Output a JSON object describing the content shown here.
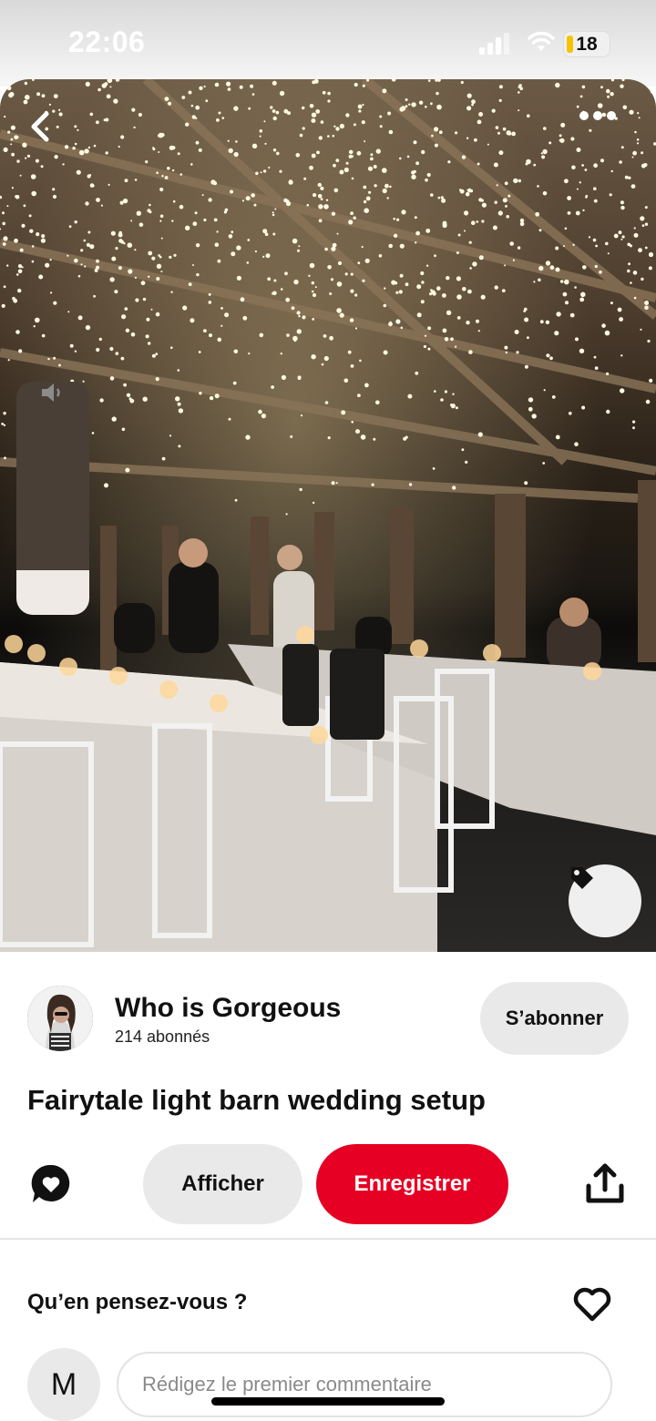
{
  "status_bar": {
    "time": "22:06",
    "battery": "18",
    "icons": [
      "cellular-signal-icon",
      "wifi-icon",
      "battery-icon"
    ]
  },
  "hero": {
    "icons": [
      "back-chevron-icon",
      "more-dots-icon",
      "speaker-icon",
      "tag-icon"
    ],
    "volume_level": 0.19
  },
  "creator": {
    "name": "Who is Gorgeous",
    "followers": "214 abonnés",
    "follow_label": "S’abonner"
  },
  "pin": {
    "title": "Fairytale light barn wedding setup"
  },
  "actions": {
    "view_label": "Afficher",
    "save_label": "Enregistrer",
    "icons": [
      "comment-bubble-icon",
      "share-icon"
    ]
  },
  "comments": {
    "prompt": "Qu’en pensez-vous ?",
    "user_initial": "M",
    "placeholder": "Rédigez le premier commentaire"
  },
  "colors": {
    "accent": "#e60023",
    "button_grey": "#e9e9e9"
  }
}
